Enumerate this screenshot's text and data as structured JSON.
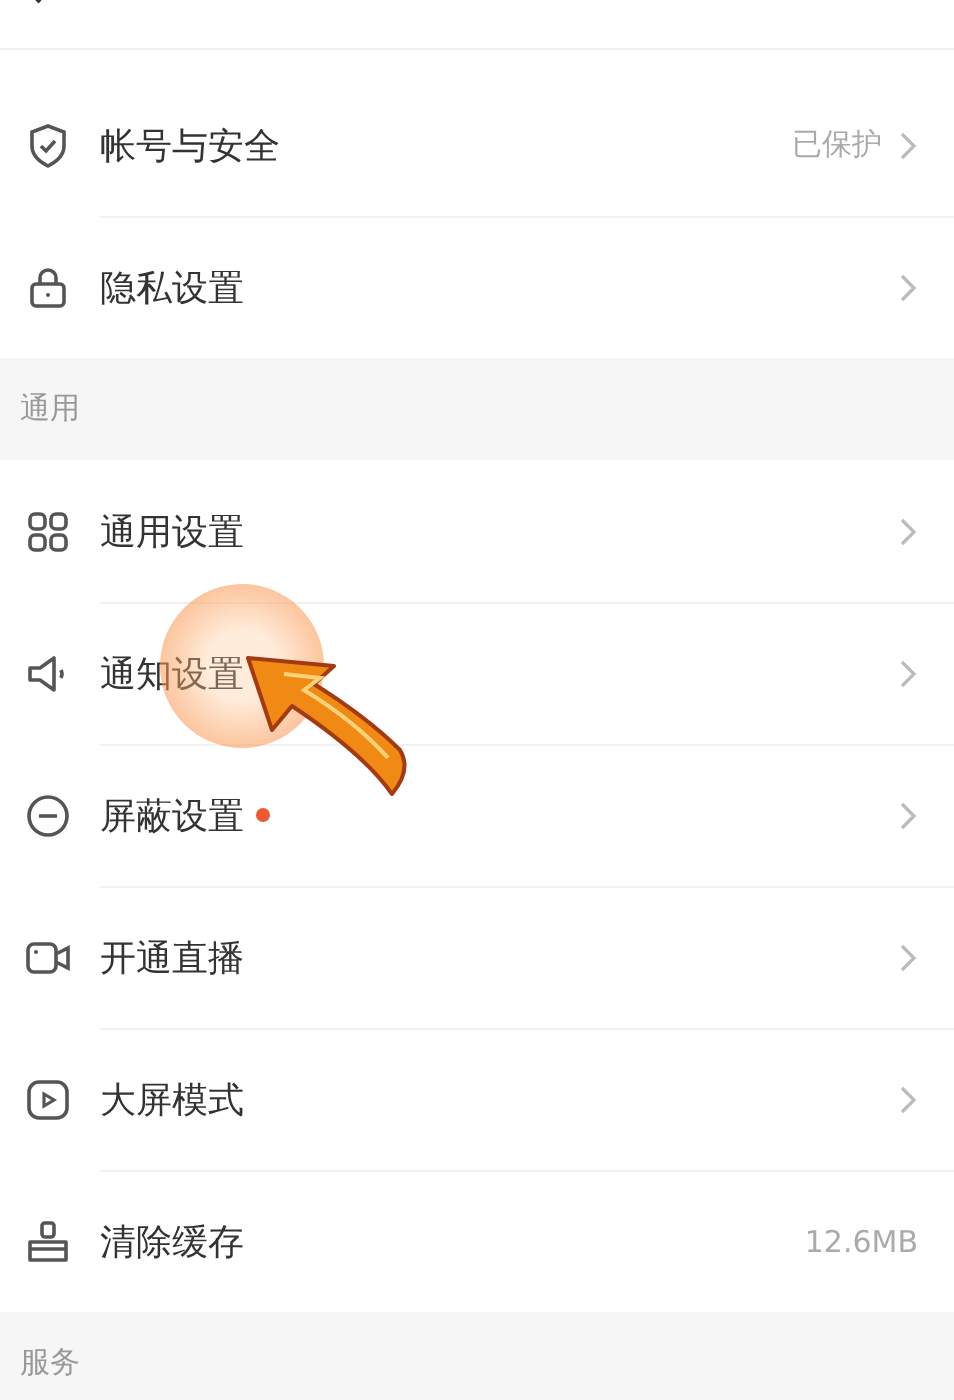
{
  "sections": [
    {
      "items": [
        {
          "label": "帐号与安全",
          "value": "已保护",
          "chevron": true,
          "dot": false
        },
        {
          "label": "隐私设置",
          "chevron": true,
          "dot": false
        }
      ]
    },
    {
      "header": "通用",
      "items": [
        {
          "label": "通用设置",
          "chevron": true,
          "dot": false
        },
        {
          "label": "通知设置",
          "chevron": true,
          "dot": false
        },
        {
          "label": "屏蔽设置",
          "chevron": true,
          "dot": true
        },
        {
          "label": "开通直播",
          "chevron": true,
          "dot": false
        },
        {
          "label": "大屏模式",
          "chevron": true,
          "dot": false
        },
        {
          "label": "清除缓存",
          "value": "12.6MB",
          "chevron": false,
          "dot": false
        }
      ]
    },
    {
      "header": "服务"
    }
  ]
}
